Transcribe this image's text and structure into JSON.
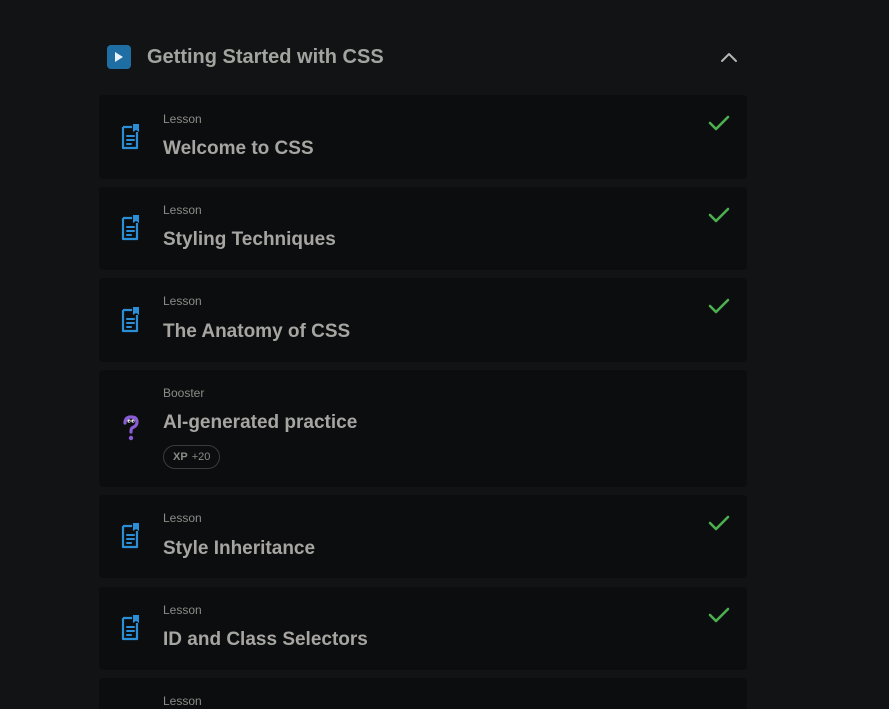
{
  "section": {
    "title": "Getting Started with CSS",
    "icon": "play-icon",
    "toggle_icon": "chevron-up-icon"
  },
  "colors": {
    "background": "#121314",
    "card": "#0c0d0e",
    "lesson_icon": "#2a8fd6",
    "check": "#4caf50",
    "booster_icon": "#8a5cd6",
    "play_bg": "#1f6ea3"
  },
  "items": [
    {
      "type": "Lesson",
      "title": "Welcome to CSS",
      "icon": "document-icon",
      "completed": true
    },
    {
      "type": "Lesson",
      "title": "Styling Techniques",
      "icon": "document-icon",
      "completed": true
    },
    {
      "type": "Lesson",
      "title": "The Anatomy of CSS",
      "icon": "document-icon",
      "completed": true
    },
    {
      "type": "Booster",
      "title": "AI-generated practice",
      "icon": "question-mark-icon",
      "completed": false,
      "xp_label": "XP",
      "xp_value": "+20"
    },
    {
      "type": "Lesson",
      "title": "Style Inheritance",
      "icon": "document-icon",
      "completed": true
    },
    {
      "type": "Lesson",
      "title": "ID and Class Selectors",
      "icon": "document-icon",
      "completed": true
    },
    {
      "type": "Lesson",
      "title": "",
      "icon": "document-icon",
      "completed": false
    }
  ]
}
